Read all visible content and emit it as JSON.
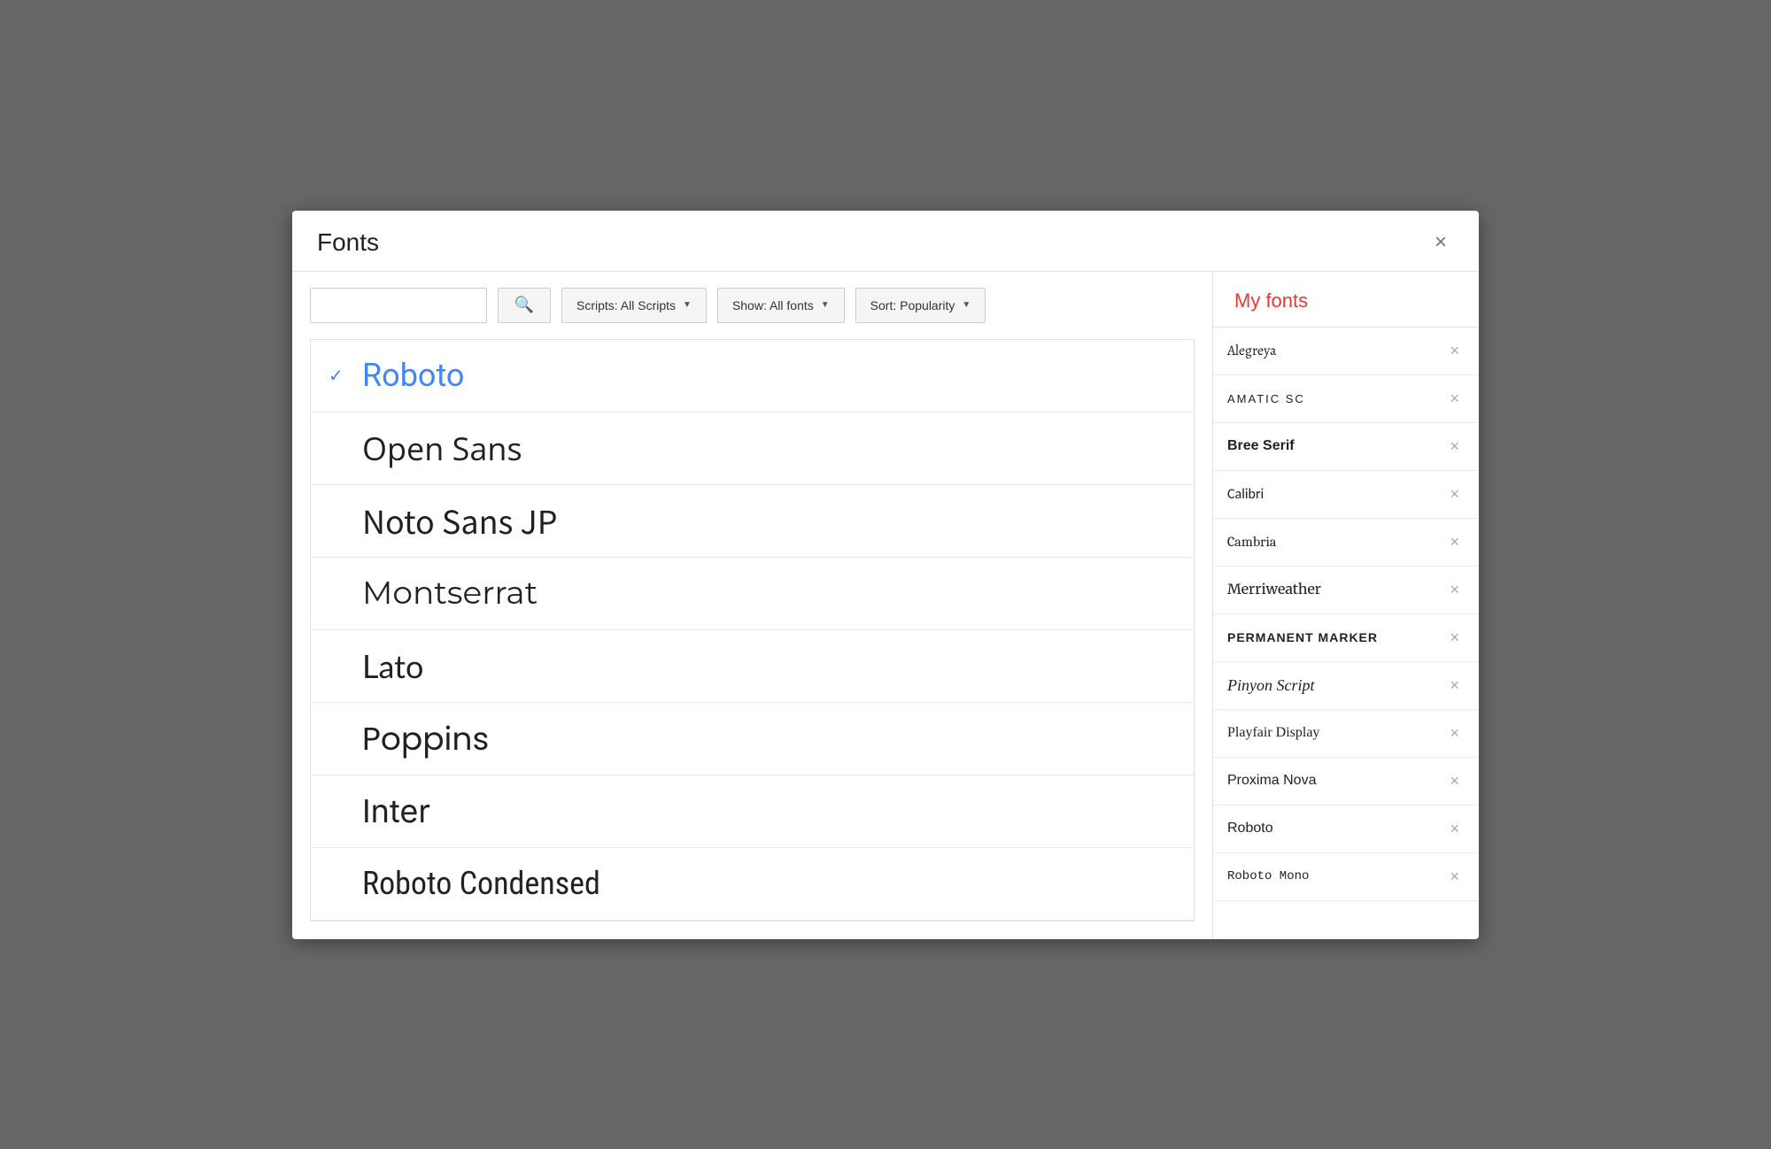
{
  "dialog": {
    "title": "Fonts",
    "close_label": "×"
  },
  "search": {
    "placeholder": "",
    "search_button_icon": "🔍",
    "filters": [
      {
        "label": "Scripts: All Scripts",
        "key": "scripts"
      },
      {
        "label": "Show: All fonts",
        "key": "show"
      },
      {
        "label": "Sort: Popularity",
        "key": "sort"
      }
    ]
  },
  "font_list": {
    "items": [
      {
        "name": "Roboto",
        "selected": true,
        "class": "font-item-roboto"
      },
      {
        "name": "Open Sans",
        "selected": false,
        "class": "font-item-opensans"
      },
      {
        "name": "Noto Sans JP",
        "selected": false,
        "class": "font-item-notosans"
      },
      {
        "name": "Montserrat",
        "selected": false,
        "class": "font-item-montserrat"
      },
      {
        "name": "Lato",
        "selected": false,
        "class": "font-item-lato"
      },
      {
        "name": "Poppins",
        "selected": false,
        "class": "font-item-poppins"
      },
      {
        "name": "Inter",
        "selected": false,
        "class": "font-item-inter"
      },
      {
        "name": "Roboto Condensed",
        "selected": false,
        "class": "font-item-robotocondensed"
      }
    ]
  },
  "my_fonts": {
    "header": "My fonts",
    "items": [
      {
        "name": "Alegreya",
        "font_class": "mf-alegreya"
      },
      {
        "name": "Amatic SC",
        "font_class": "mf-amatic"
      },
      {
        "name": "Bree Serif",
        "font_class": "mf-bree"
      },
      {
        "name": "Calibri",
        "font_class": "mf-calibri"
      },
      {
        "name": "Cambria",
        "font_class": "mf-cambria"
      },
      {
        "name": "Merriweather",
        "font_class": "mf-merriweather"
      },
      {
        "name": "Permanent Marker",
        "font_class": "mf-permanent"
      },
      {
        "name": "Pinyon Script",
        "font_class": "mf-pinyon"
      },
      {
        "name": "Playfair Display",
        "font_class": "mf-playfair"
      },
      {
        "name": "Proxima Nova",
        "font_class": "mf-proxima"
      },
      {
        "name": "Roboto",
        "font_class": "mf-roboto"
      },
      {
        "name": "Roboto Mono",
        "font_class": "mf-robotomono"
      }
    ],
    "remove_label": "×"
  }
}
